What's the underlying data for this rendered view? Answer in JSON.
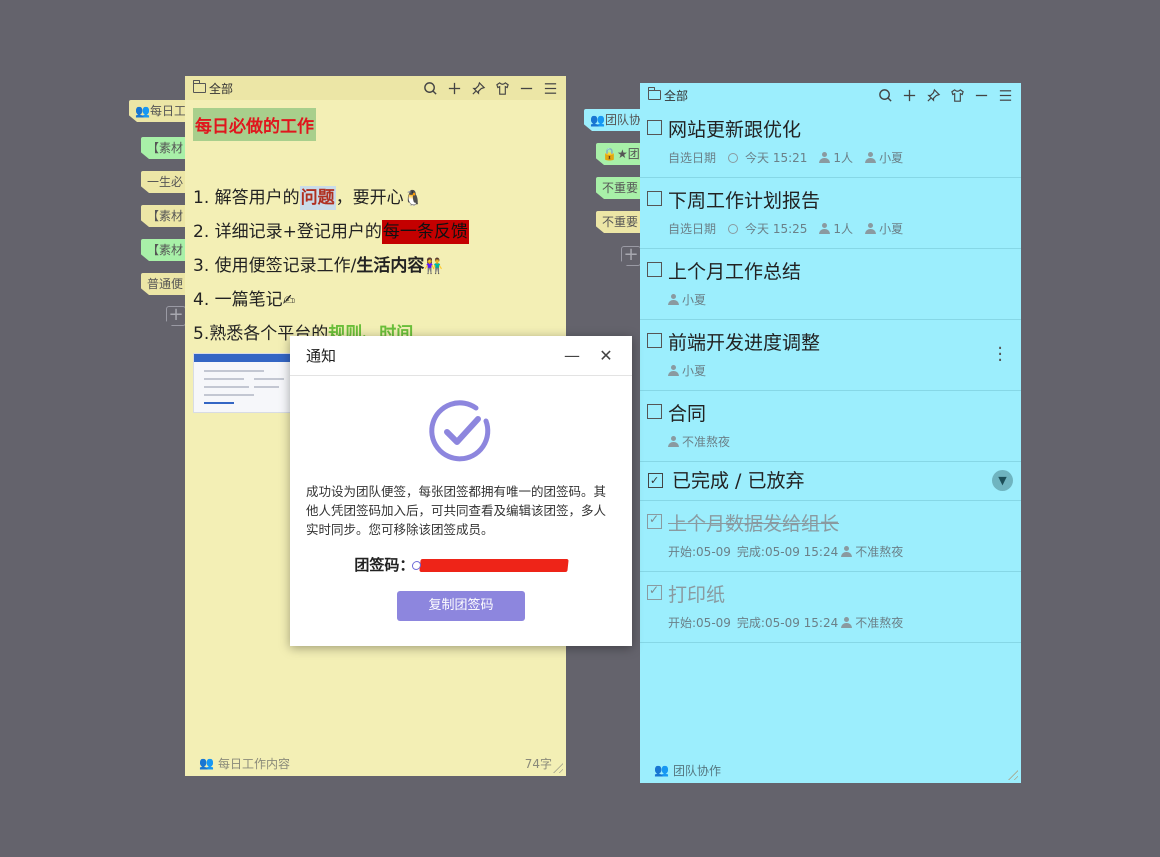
{
  "left_tabs": [
    {
      "label": "每日工…",
      "color": "#ece6a6",
      "text_color": "#555",
      "icon": "people-icon"
    },
    {
      "label": "【素材",
      "color": "#a8f0a8",
      "text_color": "#555"
    },
    {
      "label": "一生必",
      "color": "#ece6a6",
      "text_color": "#555"
    },
    {
      "label": "【素材",
      "color": "#ece6a6",
      "text_color": "#555"
    },
    {
      "label": "【素材",
      "color": "#a8f0a8",
      "text_color": "#555"
    },
    {
      "label": "普通便",
      "color": "#ece6a6",
      "text_color": "#555"
    }
  ],
  "right_tabs": [
    {
      "label": "团队协…",
      "color": "#9ceefd",
      "text_color": "#555",
      "icon": "people-icon"
    },
    {
      "label": "★团",
      "color": "#a8f0a8",
      "text_color": "#555",
      "icon": "lock-icon"
    },
    {
      "label": "不重要",
      "color": "#a8f0a8",
      "text_color": "#555"
    },
    {
      "label": "不重要",
      "color": "#ece6a6",
      "text_color": "#555"
    }
  ],
  "left_note": {
    "folder": "全部",
    "title": "每日必做的工作",
    "lines": {
      "l1_a": "1. 解答用户的",
      "l1_hl": "问题",
      "l1_b": "，要开心",
      "l2_a": "2. 详细记录+登记用户的",
      "l2_hl": "每一条反馈",
      "l3_a": "3. 使用便签记录工作/",
      "l3_b": "生活内容",
      "l4": "4. 一篇笔记",
      "l5_a": "5.熟悉各个平台的",
      "l5_b": "规则、时间"
    },
    "footer_label": "每日工作内容",
    "word_count": "74字"
  },
  "right_note": {
    "folder": "全部",
    "tasks": [
      {
        "title": "网站更新跟优化",
        "date": "自选日期",
        "time": "今天 15:21",
        "count": "1人",
        "person": "小夏"
      },
      {
        "title": "下周工作计划报告",
        "date": "自选日期",
        "time": "今天 15:25",
        "count": "1人",
        "person": "小夏"
      },
      {
        "title": "上个月工作总结",
        "person": "小夏"
      },
      {
        "title": "前端开发进度调整",
        "person": "小夏"
      },
      {
        "title": "合同",
        "person": "不准熬夜"
      }
    ],
    "completed_section": "已完成 / 已放弃",
    "done_tasks": [
      {
        "title": "上个月数据发给组长",
        "start": "开始:05-09",
        "finish": "完成:05-09 15:24",
        "person": "不准熬夜"
      },
      {
        "title": "打印纸",
        "start": "开始:05-09",
        "finish": "完成:05-09 15:24",
        "person": "不准熬夜"
      }
    ],
    "footer_label": "团队协作"
  },
  "dialog": {
    "title": "通知",
    "message": "成功设为团队便签，每张团签都拥有唯一的团签码。其他人凭团签码加入后，可共同查看及编辑该团签，多人实时同步。您可移除该团签成员。",
    "code_label": "团签码：",
    "copy_button": "复制团签码",
    "accent": "#8d86de"
  }
}
